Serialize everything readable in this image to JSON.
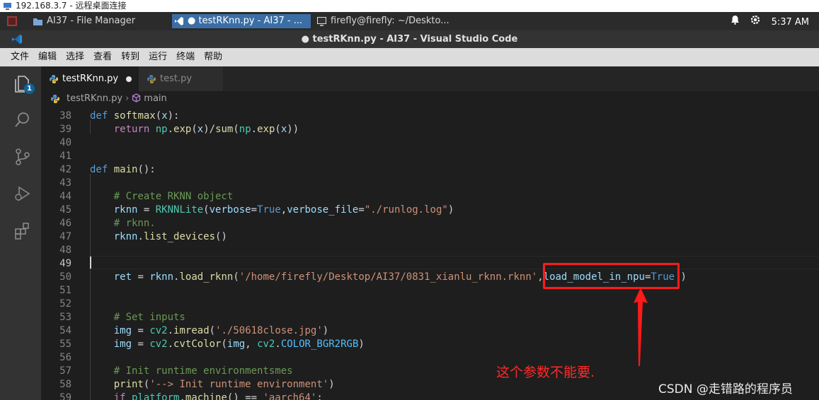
{
  "remote_desktop": {
    "title": "192.168.3.7 - 远程桌面连接"
  },
  "taskbar": {
    "tasks": [
      {
        "label": "AI37 - File Manager"
      },
      {
        "label": "● testRKnn.py - AI37 - ..."
      },
      {
        "label": "firefly@firefly: ~/Deskto..."
      }
    ],
    "clock": "5:37 AM"
  },
  "window": {
    "title": "● testRKnn.py - AI37 - Visual Studio Code"
  },
  "menu": [
    "文件",
    "编辑",
    "选择",
    "查看",
    "转到",
    "运行",
    "终端",
    "帮助"
  ],
  "activity": {
    "explorer_badge": "1"
  },
  "tabs": [
    {
      "label": "testRKnn.py"
    },
    {
      "label": "test.py"
    }
  ],
  "breadcrumb": {
    "file": "testRKnn.py",
    "symbol": "main"
  },
  "editor": {
    "line_numbers": [
      "38",
      "39",
      "40",
      "41",
      "42",
      "43",
      "44",
      "45",
      "46",
      "47",
      "48",
      "49",
      "50",
      "51",
      "52",
      "53",
      "54",
      "55",
      "56",
      "57",
      "58",
      "59"
    ]
  },
  "annotation": {
    "note": "这个参数不能要.",
    "accent_color": "#ff1a1a"
  },
  "watermark": "CSDN @走错路的程序员"
}
